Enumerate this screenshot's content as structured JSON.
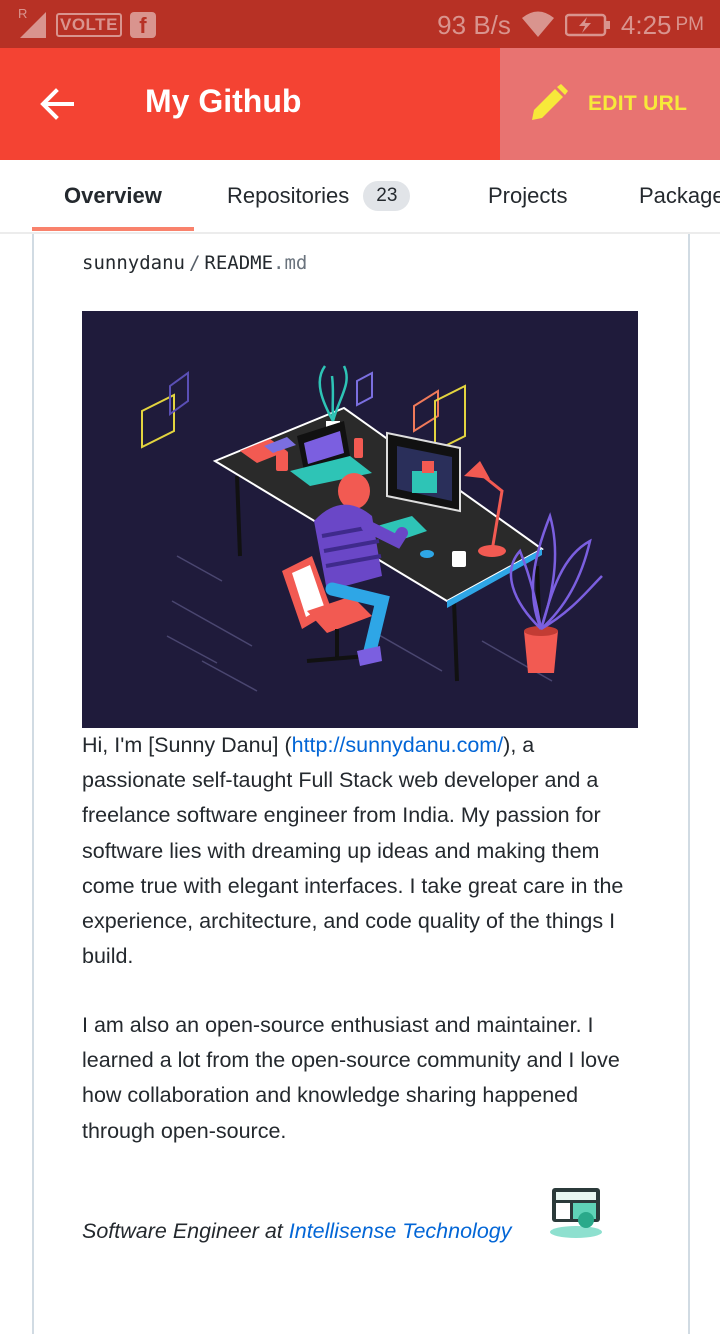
{
  "status_bar": {
    "carrier_indicator": "R",
    "volte": "VOLTE",
    "network_speed": "93 B/s",
    "time": "4:25",
    "ampm": "PM",
    "icons": [
      "signal-icon",
      "facebook-icon",
      "wifi-icon",
      "battery-charging-icon"
    ]
  },
  "app_bar": {
    "title": "My Github",
    "edit_label": "EDIT URL",
    "back_icon": "arrow-back-icon",
    "edit_icon": "pencil-icon",
    "colors": {
      "primary": "#f44333",
      "edit_bg": "#e87371",
      "edit_text": "#f7e93a"
    }
  },
  "tabs": [
    {
      "label": "Overview",
      "active": true
    },
    {
      "label": "Repositories",
      "count": "23"
    },
    {
      "label": "Projects"
    },
    {
      "label": "Packages"
    }
  ],
  "readme": {
    "owner": "sunnydanu",
    "separator": "/",
    "file_name": "README",
    "file_ext": ".md",
    "intro_prefix": "Hi, I'm [Sunny Danu] (",
    "intro_link": "http://sunnydanu.com/",
    "intro_suffix": "), a passionate self-taught Full Stack web developer and a freelance software engineer from India. My passion for software lies with dreaming up ideas and making them come true with elegant interfaces. I take great care in the experience, architecture, and code quality of the things I build.",
    "paragraph2": "I am also an open-source enthusiast and maintainer. I learned a lot from the open-source community and I love how collaboration and knowledge sharing happened through open-source.",
    "role_prefix": "Software Engineer at ",
    "company": "Intellisense Technology"
  }
}
